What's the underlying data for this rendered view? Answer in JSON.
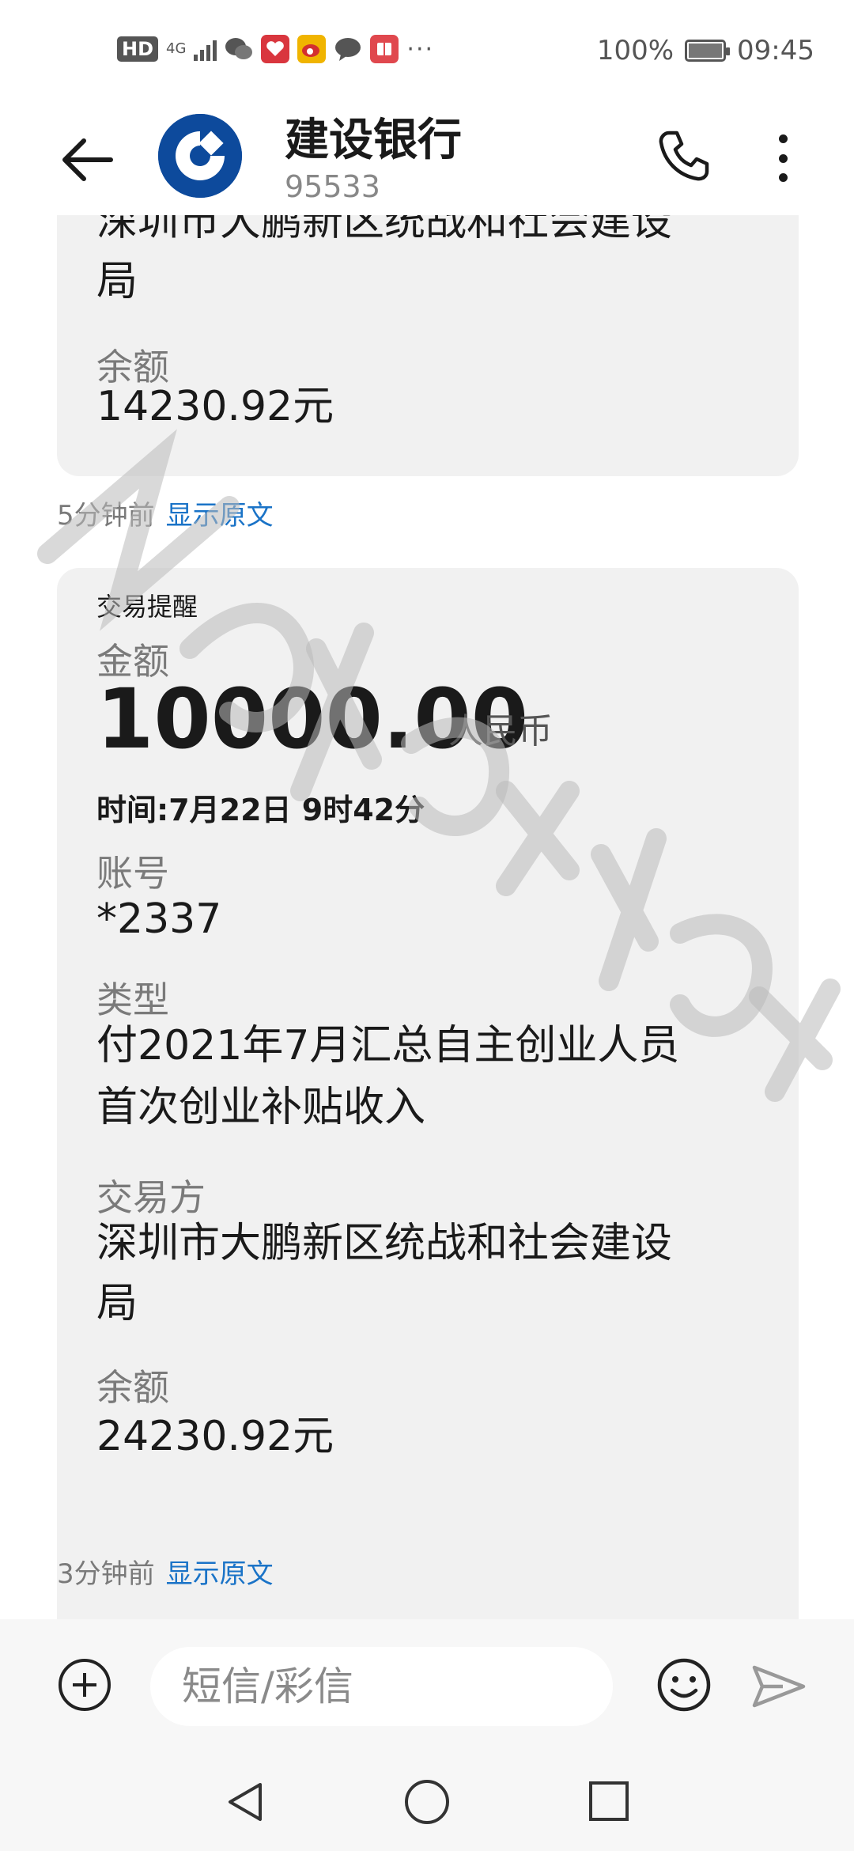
{
  "status_bar": {
    "hd_badge": "HD",
    "network": "4G",
    "battery_percent": "100%",
    "battery_level": 1.0,
    "time": "09:45",
    "more": "···"
  },
  "header": {
    "title": "建设银行",
    "number": "95533"
  },
  "messages": [
    {
      "party_line1": "深圳市大鹏新区统战和社会建设",
      "party_line2": "局",
      "balance_label": "余额",
      "balance_value": "14230.92元",
      "time_ago": "5分钟前",
      "show_original": "显示原文"
    },
    {
      "tag": "交易提醒",
      "amount_label": "金额",
      "amount_value": "10000.00",
      "currency": "人民币",
      "time_line": "时间:7月22日 9时42分",
      "account_label": "账号",
      "account_value": "*2337",
      "type_label": "类型",
      "type_line1": "付2021年7月汇总自主创业人员",
      "type_line2": "首次创业补贴收入",
      "party_label": "交易方",
      "party_line1": "深圳市大鹏新区统战和社会建设",
      "party_line2": "局",
      "balance_label": "余额",
      "balance_value": "24230.92元",
      "time_ago": "3分钟前",
      "show_original": "显示原文"
    }
  ],
  "compose": {
    "placeholder": "短信/彩信"
  },
  "colors": {
    "link": "#1a73c7",
    "bank_blue": "#0d4a9c",
    "bubble": "#f1f1f1"
  }
}
